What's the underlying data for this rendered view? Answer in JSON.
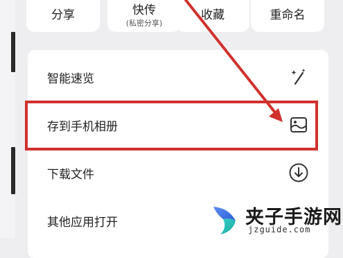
{
  "quick_actions": [
    {
      "label": "分享",
      "sub": ""
    },
    {
      "label": "快传",
      "sub": "(私密分享)"
    },
    {
      "label": "收藏",
      "sub": ""
    },
    {
      "label": "重命名",
      "sub": ""
    }
  ],
  "menu": {
    "items": [
      {
        "label": "智能速览",
        "icon": "magic-wand-icon"
      },
      {
        "label": "存到手机相册",
        "icon": "save-to-album-icon"
      },
      {
        "label": "下载文件",
        "icon": "download-circle-icon"
      },
      {
        "label": "其他应用打开",
        "icon": ""
      }
    ]
  },
  "annotation": {
    "color": "#d0312d"
  },
  "watermark": {
    "title": "夹子手游网",
    "url": "jzguide.com"
  }
}
